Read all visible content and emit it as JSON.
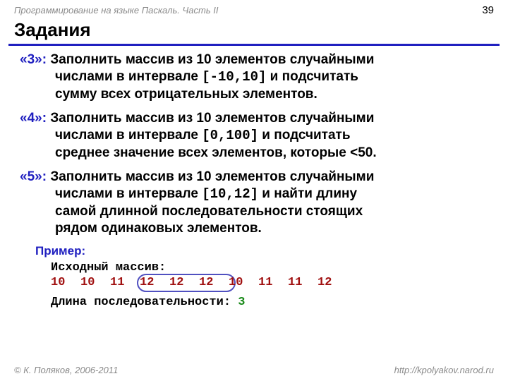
{
  "header": {
    "course": "Программирование на языке Паскаль. Часть II",
    "pagenum": "39"
  },
  "title": "Задания",
  "tasks": {
    "t3": {
      "label": "«3»:",
      "line1": "Заполнить массив из 10 элементов случайными",
      "line2": "числами в интервале ",
      "range": "[-10,10]",
      "line2b": " и подсчитать",
      "line3": "сумму всех отрицательных элементов."
    },
    "t4": {
      "label": "«4»:",
      "line1": "Заполнить массив из 10 элементов случайными",
      "line2": "числами в интервале ",
      "range": "[0,100]",
      "line2b": " и подсчитать",
      "line3": "среднее значение всех элементов, которые <50."
    },
    "t5": {
      "label": "«5»:",
      "line1": "Заполнить массив из 10 элементов случайными",
      "line2": "числами в интервале ",
      "range": "[10,12]",
      "line2b": " и найти длину",
      "line3": "самой длинной последовательности стоящих",
      "line4": "рядом одинаковых элементов."
    }
  },
  "example": {
    "title": "Пример:",
    "src_label": "Исходный массив:",
    "arr": [
      "10",
      "10",
      "11",
      "12",
      "12",
      "12",
      "10",
      "11",
      "11",
      "12"
    ],
    "seq_label": "Длина последовательности: ",
    "seq_val": "3"
  },
  "footer": {
    "copyright": "© К. Поляков, 2006-2011",
    "url": "http://kpolyakov.narod.ru"
  }
}
